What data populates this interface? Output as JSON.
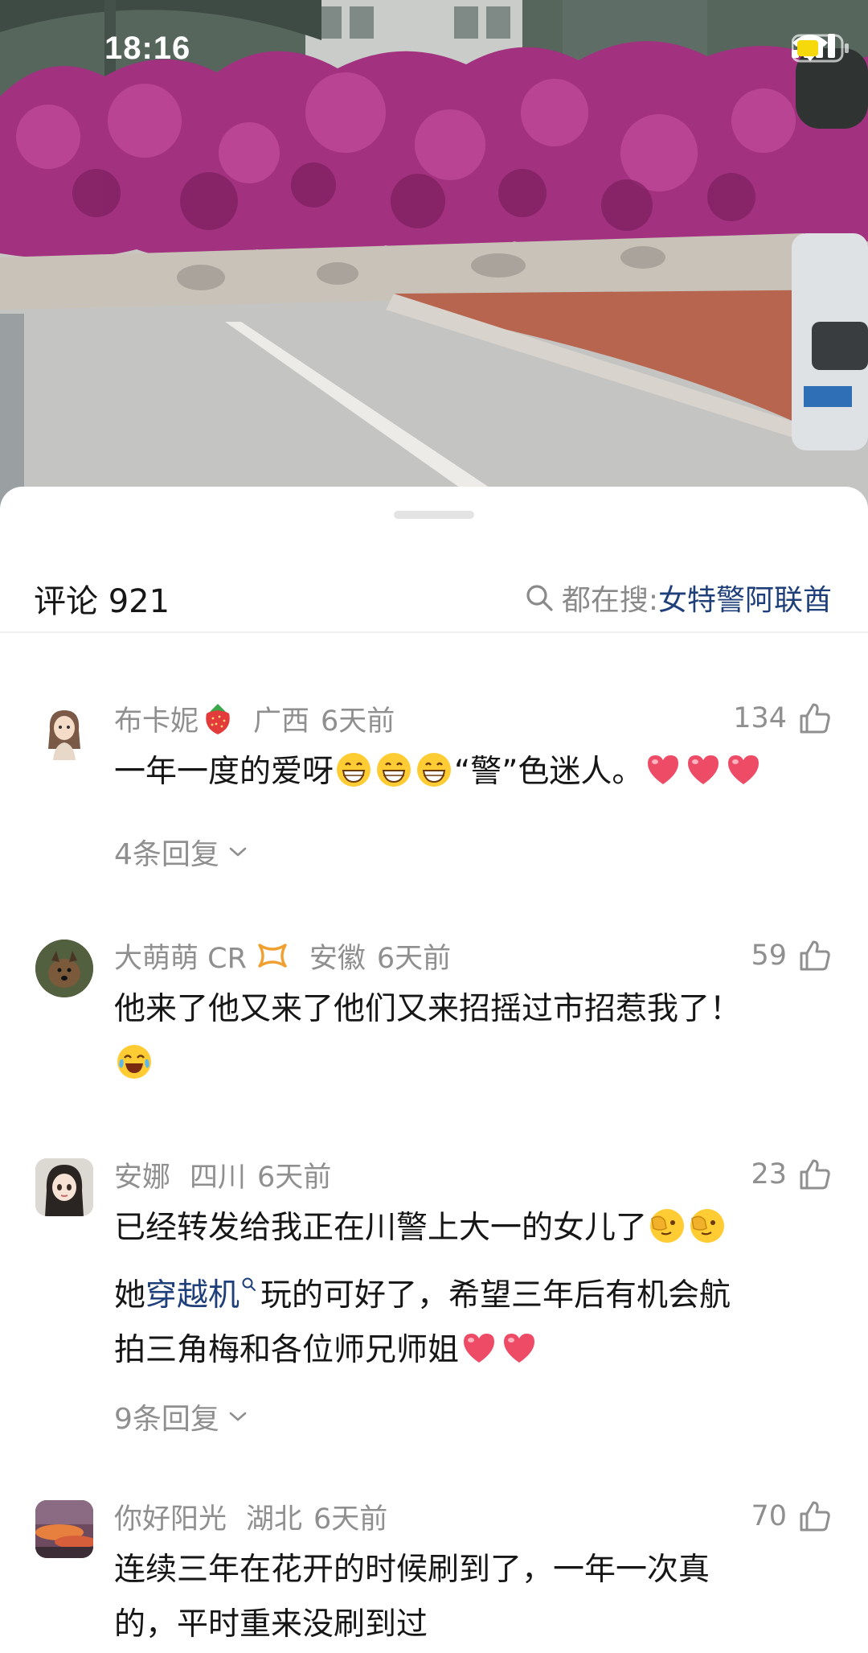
{
  "status_bar": {
    "time": "18:16",
    "icons": [
      "signal-icon",
      "wifi-icon",
      "battery-icon"
    ]
  },
  "sheet": {
    "title": "评论 921",
    "hot_search_label": "都在搜:",
    "hot_search_term": "女特警阿联酋"
  },
  "comments": [
    {
      "name": "布卡妮",
      "badge": "strawberry-icon",
      "location": "广西",
      "time": "6天前",
      "likes": "134",
      "lines": [
        {
          "parts": [
            {
              "t": "一年一度的爱呀"
            },
            {
              "e": "grin"
            },
            {
              "e": "grin"
            },
            {
              "e": "grin"
            },
            {
              "t": "“警”色迷人。"
            },
            {
              "e": "heart"
            },
            {
              "e": "heart"
            },
            {
              "e": "heart"
            }
          ]
        }
      ],
      "replies": "4条回复"
    },
    {
      "name": "大萌萌 CR",
      "badge": "ribbon-icon",
      "location": "安徽",
      "time": "6天前",
      "likes": "59",
      "lines": [
        {
          "parts": [
            {
              "t": "他来了他又来了他们又来招摇过市招惹我了！"
            }
          ]
        },
        {
          "parts": [
            {
              "e": "laugh-cry"
            }
          ]
        }
      ]
    },
    {
      "name": "安娜",
      "location": "四川",
      "time": "6天前",
      "likes": "23",
      "lines": [
        {
          "parts": [
            {
              "t": "已经转发给我正在川警上大一的女儿了"
            },
            {
              "e": "peek"
            },
            {
              "e": "peek"
            }
          ]
        },
        {
          "parts": [
            {
              "t": "她"
            },
            {
              "link": "穿越机"
            },
            {
              "t": "玩的可好了，希望三年后有机会航"
            }
          ]
        },
        {
          "parts": [
            {
              "t": "拍三角梅和各位师兄师姐"
            },
            {
              "e": "heart"
            },
            {
              "e": "heart"
            }
          ]
        }
      ],
      "replies": "9条回复"
    },
    {
      "name": "你好阳光",
      "location": "湖北",
      "time": "6天前",
      "likes": "70",
      "lines": [
        {
          "parts": [
            {
              "t": "连续三年在花开的时候刷到了，一年一次真"
            }
          ]
        },
        {
          "parts": [
            {
              "t": "的，平时重来没刷到过"
            }
          ]
        }
      ]
    }
  ]
}
